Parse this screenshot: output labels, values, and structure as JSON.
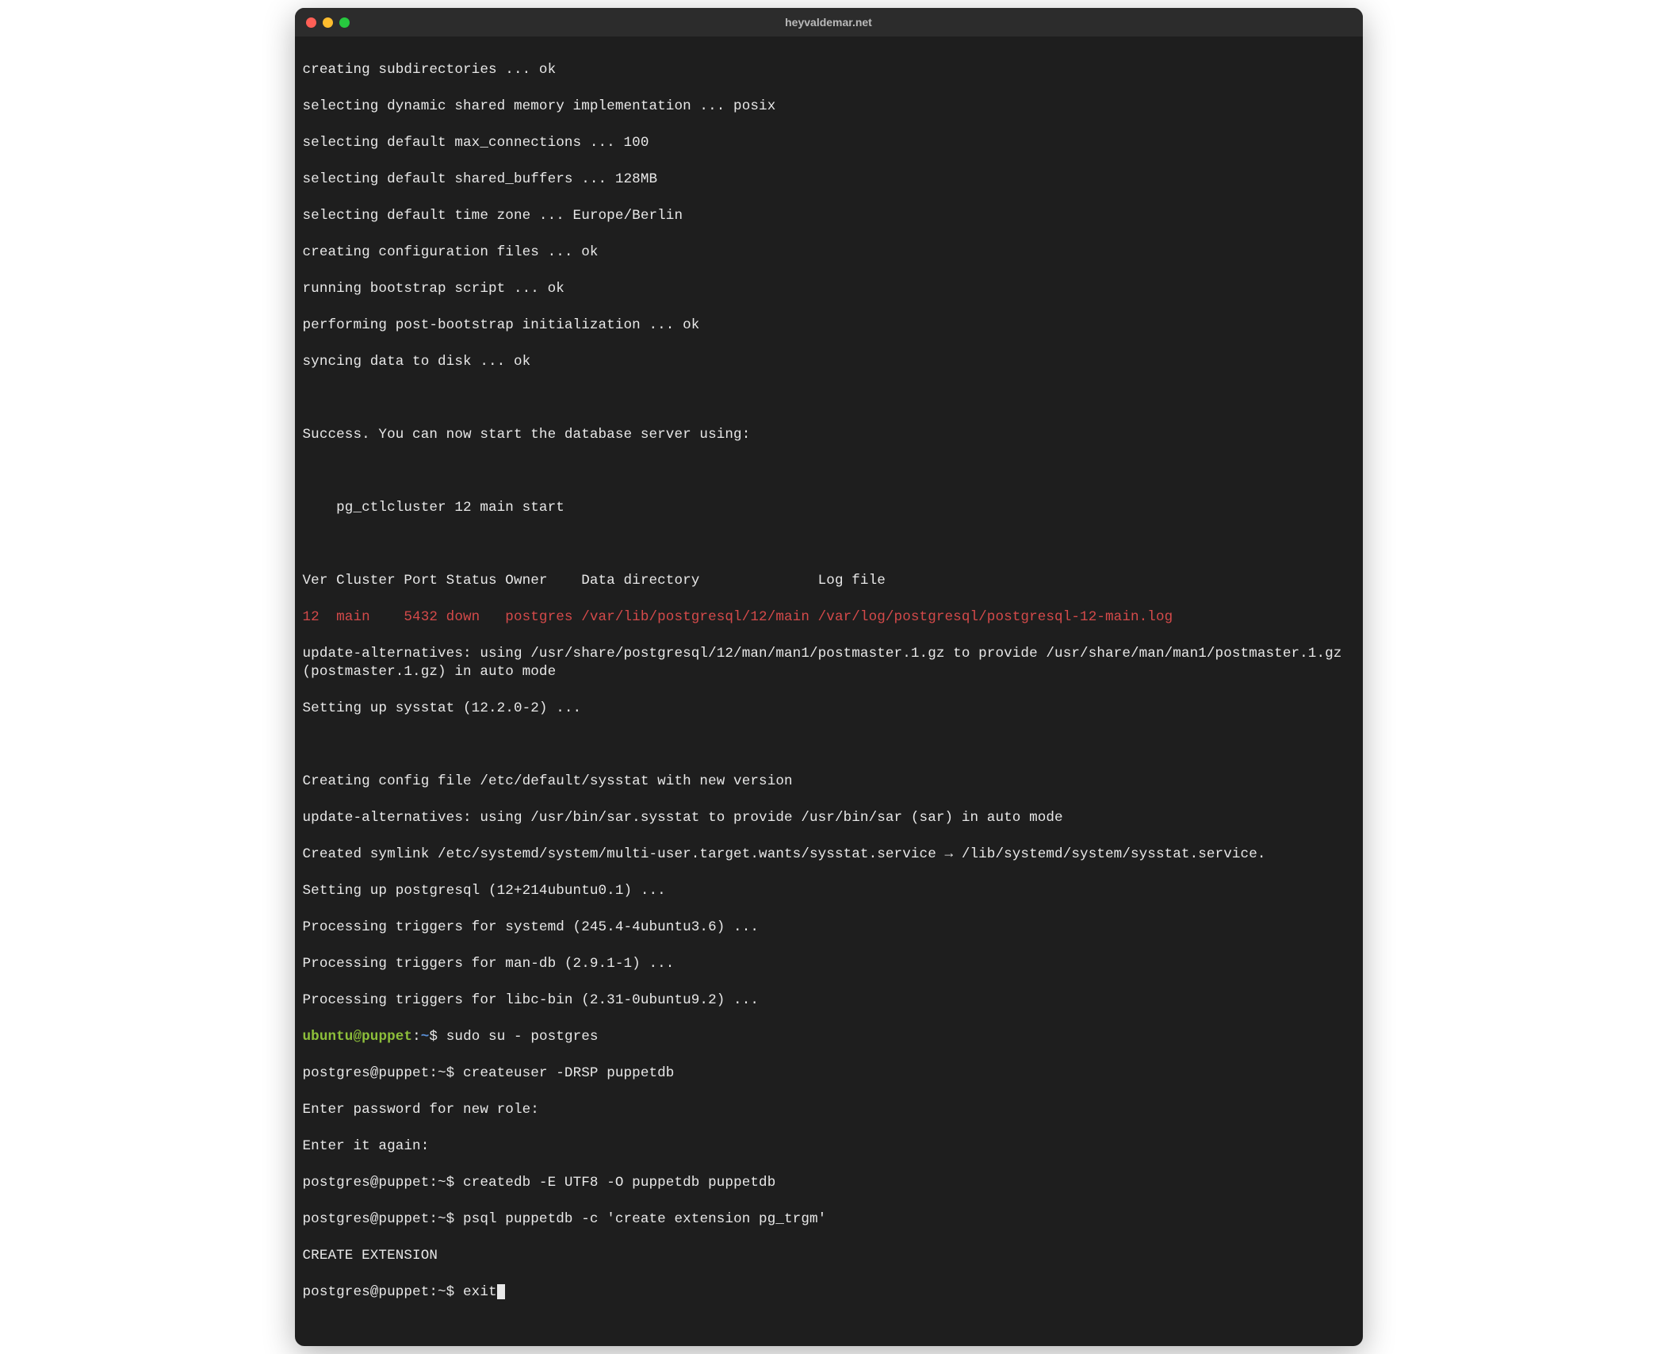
{
  "window": {
    "title": "heyvaldemar.net"
  },
  "colors": {
    "bg": "#1e1e1e",
    "titlebar": "#2c2c2c",
    "text": "#e8e8e8",
    "red": "#d44a4a",
    "green_prompt": "#8dbf3a",
    "blue_path": "#5a8fd6"
  },
  "output": {
    "l1": "creating subdirectories ... ok",
    "l2": "selecting dynamic shared memory implementation ... posix",
    "l3": "selecting default max_connections ... 100",
    "l4": "selecting default shared_buffers ... 128MB",
    "l5": "selecting default time zone ... Europe/Berlin",
    "l6": "creating configuration files ... ok",
    "l7": "running bootstrap script ... ok",
    "l8": "performing post-bootstrap initialization ... ok",
    "l9": "syncing data to disk ... ok",
    "l10": "Success. You can now start the database server using:",
    "l11": "    pg_ctlcluster 12 main start",
    "l12": "Ver Cluster Port Status Owner    Data directory              Log file",
    "l13": "12  main    5432 down   postgres /var/lib/postgresql/12/main /var/log/postgresql/postgresql-12-main.log",
    "l14": "update-alternatives: using /usr/share/postgresql/12/man/man1/postmaster.1.gz to provide /usr/share/man/man1/postmaster.1.gz (postmaster.1.gz) in auto mode",
    "l15": "Setting up sysstat (12.2.0-2) ...",
    "l16": "Creating config file /etc/default/sysstat with new version",
    "l17": "update-alternatives: using /usr/bin/sar.sysstat to provide /usr/bin/sar (sar) in auto mode",
    "l18": "Created symlink /etc/systemd/system/multi-user.target.wants/sysstat.service → /lib/systemd/system/sysstat.service.",
    "l19": "Setting up postgresql (12+214ubuntu0.1) ...",
    "l20": "Processing triggers for systemd (245.4-4ubuntu3.6) ...",
    "l21": "Processing triggers for man-db (2.9.1-1) ...",
    "l22": "Processing triggers for libc-bin (2.31-0ubuntu9.2) ..."
  },
  "prompts": {
    "ubuntu": {
      "user": "ubuntu",
      "at": "@",
      "host": "puppet",
      "colon": ":",
      "path": "~",
      "dollar": "$ ",
      "cmd": "sudo su - postgres"
    },
    "p2": {
      "prefix": "postgres@puppet:~$ ",
      "cmd": "createuser -DRSP puppetdb"
    },
    "p3": {
      "text": "Enter password for new role:"
    },
    "p4": {
      "text": "Enter it again:"
    },
    "p5": {
      "prefix": "postgres@puppet:~$ ",
      "cmd": "createdb -E UTF8 -O puppetdb puppetdb"
    },
    "p6": {
      "prefix": "postgres@puppet:~$ ",
      "cmd": "psql puppetdb -c 'create extension pg_trgm'"
    },
    "p7": {
      "text": "CREATE EXTENSION"
    },
    "p8": {
      "prefix": "postgres@puppet:~$ ",
      "cmd": "exit"
    }
  }
}
